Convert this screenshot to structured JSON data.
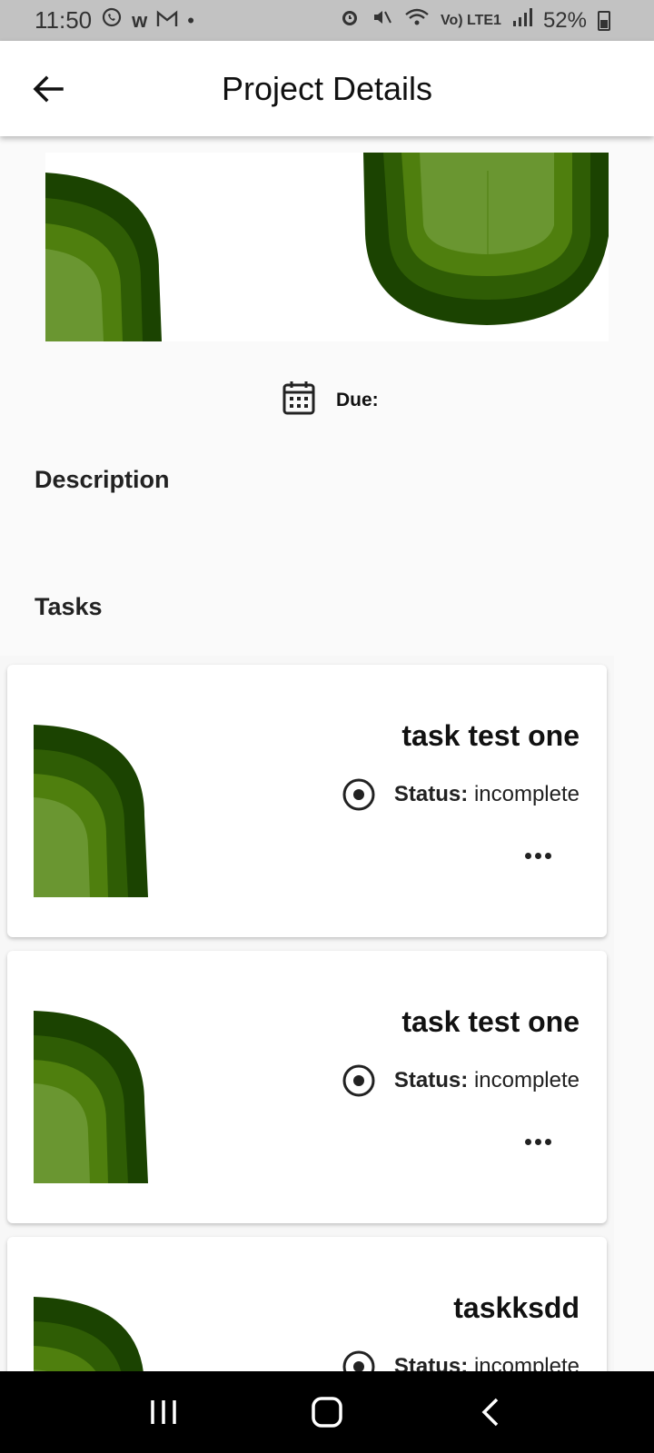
{
  "status_bar": {
    "time": "11:50",
    "app_icons": [
      "whatsapp-icon",
      "w-app-icon",
      "gmail-icon",
      "dot-icon"
    ],
    "battery": "52%",
    "network_label": "Vo) LTE1"
  },
  "app_bar": {
    "title": "Project Details",
    "back_icon": "arrow-left-icon"
  },
  "project": {
    "due_label": "Due:",
    "due_value": "",
    "description_heading": "Description",
    "description_text": "",
    "tasks_heading": "Tasks"
  },
  "tasks": [
    {
      "name": "task test one",
      "status_label": "Status:",
      "status_value": "incomplete"
    },
    {
      "name": "task test one",
      "status_label": "Status:",
      "status_value": "incomplete"
    },
    {
      "name": "taskksdd",
      "status_label": "Status:",
      "status_value": "incomplete"
    }
  ],
  "colors": {
    "green_darkest": "#1b4301",
    "green_dark": "#2f5d05",
    "green_mid": "#4f7f0e",
    "green_light": "#6a9631",
    "appbar_bg": "#ffffff",
    "page_bg": "#fafafa",
    "navbar_bg": "#000000"
  },
  "nav_bar": {
    "icons": [
      "recent-apps-icon",
      "home-icon",
      "back-icon"
    ]
  }
}
